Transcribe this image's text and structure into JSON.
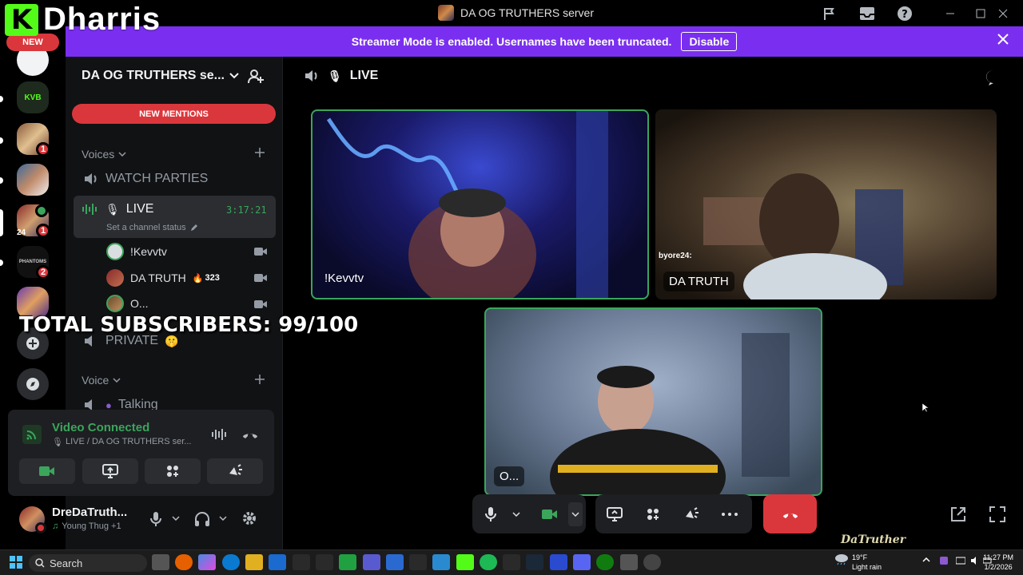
{
  "kick_overlay": {
    "logo_letter": "K",
    "channel_name": "Dharris"
  },
  "window": {
    "title": "DA OG TRUTHERS server"
  },
  "banner": {
    "message": "Streamer Mode is enabled. Usernames have been truncated.",
    "button_label": "Disable"
  },
  "rail": {
    "new_label": "NEW",
    "badges": [
      "1",
      "1",
      "2"
    ],
    "sub_badge": "24"
  },
  "sidebar": {
    "server_name": "DA OG TRUTHERS se...",
    "new_mentions": "NEW MENTIONS",
    "category_voices": "Voices",
    "channel_watch": "WATCH PARTIES",
    "live_channel": "LIVE",
    "live_timer": "3:17:21",
    "live_status_placeholder": "Set a channel status",
    "members": [
      {
        "name": "!Kevvtv",
        "extra": ""
      },
      {
        "name": "DA TRUTH",
        "extra": "323"
      },
      {
        "name": "O...",
        "extra": ""
      }
    ],
    "channel_private": "PRIVATE",
    "category_voice": "Voice",
    "channel_talking": "Talking"
  },
  "voice_panel": {
    "status": "Video Connected",
    "location": "LIVE / DA OG TRUTHERS ser..."
  },
  "user_panel": {
    "username": "DreDaTruth...",
    "activity": "Young Thug +1"
  },
  "main": {
    "header_channel": "LIVE",
    "tiles": [
      {
        "label": "!Kevvtv"
      },
      {
        "label": "DA TRUTH",
        "overlay_text": "byore24:"
      },
      {
        "label": "O..."
      }
    ]
  },
  "stream_overlay": {
    "subscribers": "TOTAL SUBSCRIBERS: 99/100",
    "watermark": "DaTruther"
  },
  "taskbar": {
    "search_label": "Search",
    "weather_temp": "19°F",
    "weather_desc": "Light rain",
    "time": "11:27 PM",
    "date": "1/2/2026"
  },
  "colors": {
    "brand_purple": "#7a2ff0",
    "kick_green": "#53fc18",
    "danger_red": "#da373c",
    "speaking_green": "#3ba55c"
  }
}
